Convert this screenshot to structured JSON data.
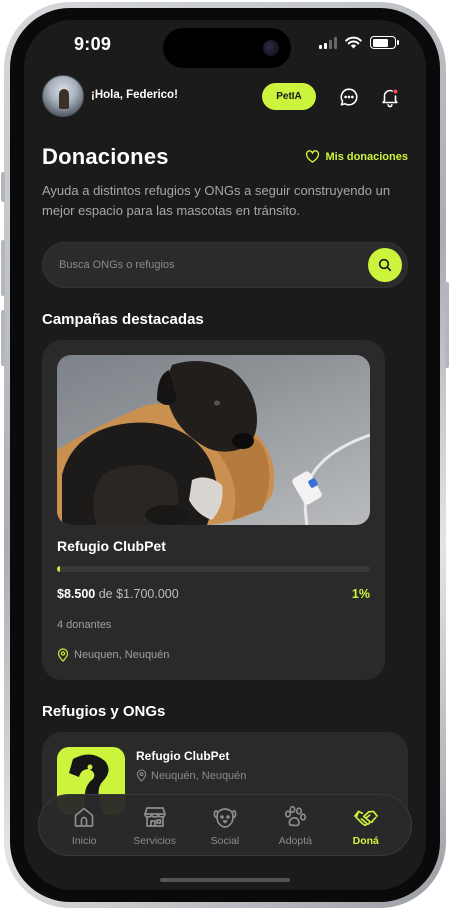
{
  "status_bar": {
    "time": "9:09"
  },
  "header": {
    "greeting": "¡Hola, Federico!",
    "petia_label": "PetIA",
    "icons": [
      "chat-icon",
      "bell-icon"
    ]
  },
  "page": {
    "title": "Donaciones",
    "my_donations_label": "Mis donaciones",
    "subtitle": "Ayuda a distintos refugios y ONGs a seguir construyendo un mejor espacio para las mascotas en tránsito."
  },
  "search": {
    "placeholder": "Busca ONGs o refugios"
  },
  "featured": {
    "section_title": "Campañas destacadas",
    "campaign": {
      "name": "Refugio ClubPet",
      "raised": "$8.500",
      "of_label": "de",
      "goal": "$1.700.000",
      "percent_label": "1%",
      "progress_fraction": 0.01,
      "donors": "4 donantes",
      "location": "Neuquen, Neuquén"
    }
  },
  "orgs": {
    "section_title": "Refugios y ONGs",
    "items": [
      {
        "name": "Refugio ClubPet",
        "location": "Neuquén, Neuquén"
      }
    ]
  },
  "nav": {
    "items": [
      {
        "label": "Inicio",
        "icon": "home-icon"
      },
      {
        "label": "Servicios",
        "icon": "store-icon"
      },
      {
        "label": "Social",
        "icon": "dog-face-icon"
      },
      {
        "label": "Adoptá",
        "icon": "paw-icon"
      },
      {
        "label": "Doná",
        "icon": "handshake-icon"
      }
    ],
    "active": "Doná"
  },
  "colors": {
    "accent": "#cdf43c",
    "background": "#1b1b1b",
    "card": "#2a2a2a"
  }
}
